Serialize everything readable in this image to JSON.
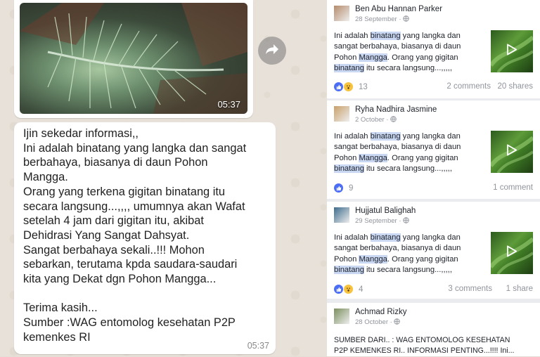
{
  "whatsapp": {
    "video_message": {
      "duration": "05:37"
    },
    "text_message": {
      "lines": [
        "Ijin sekedar informasi,,",
        "Ini adalah binatang yang langka dan sangat",
        "berbahaya, biasanya di daun Pohon",
        "Mangga.",
        "Orang yang terkena gigitan binatang itu",
        "secara langsung...,,,, umumnya akan Wafat",
        "setelah 4 jam dari gigitan itu, akibat",
        "Dehidrasi Yang Sangat Dahsyat.",
        "Sangat berbahaya sekali..!!! Mohon",
        "sebarkan, terutama kpda saudara-saudari",
        "kita yang Dekat dgn Pohon Mangga...",
        "",
        "Terima kasih...",
        "Sumber :WAG entomolog kesehatan P2P",
        "kemenkes RI"
      ],
      "time": "05:37"
    },
    "forward_icon": "forward-arrow-icon"
  },
  "facebook": {
    "posts": [
      {
        "author": "Ben Abu Hannan Parker",
        "date": "28 September",
        "text": [
          [
            "Ini adalah ",
            "binatang",
            " yang langka dan"
          ],
          [
            "sangat berbahaya, biasanya di daun"
          ],
          [
            "Pohon ",
            "Mangga",
            ". Orang yang gigitan"
          ],
          [
            "",
            "binatang",
            " itu secara langsung...,,,,,"
          ]
        ],
        "reaction_count": "13",
        "comments": "2 comments",
        "shares": "20 shares"
      },
      {
        "author": "Ryha Nadhira Jasmine",
        "date": "2 October",
        "text": [
          [
            "Ini adalah ",
            "binatang",
            " yang langka dan"
          ],
          [
            "sangat berbahaya, biasanya di daun"
          ],
          [
            "Pohon ",
            "Mangga",
            ". Orang yang gigitan"
          ],
          [
            "",
            "binatang",
            " itu secara langsung...,,,,,"
          ]
        ],
        "reaction_count": "9",
        "comments": "1 comment",
        "shares": ""
      },
      {
        "author": "Hujjatul Balighah",
        "date": "29 September",
        "text": [
          [
            "Ini adalah ",
            "binatang",
            " yang langka dan"
          ],
          [
            "sangat berbahaya, biasanya di daun"
          ],
          [
            "Pohon ",
            "Mangga",
            ". Orang yang gigitan"
          ],
          [
            "",
            "binatang",
            " itu secara langsung...,,,,,"
          ]
        ],
        "reaction_count": "4",
        "comments": "3 comments",
        "shares": "1 share"
      },
      {
        "author": "Achmad Rizky",
        "date": "28 October",
        "text": [
          [
            "SUMBER DARI.. : WAG ENTOMOLOG KESEHATAN"
          ],
          [
            "P2P KEMENKES RI.. INFORMASI PENTING...!!!! Ini..."
          ]
        ]
      }
    ],
    "globe_icon": "globe-icon",
    "colors": {
      "like_blue": "#4c6ef5",
      "highlight": "#c9d7f2",
      "wow_yellow": "#f7c33e"
    }
  }
}
